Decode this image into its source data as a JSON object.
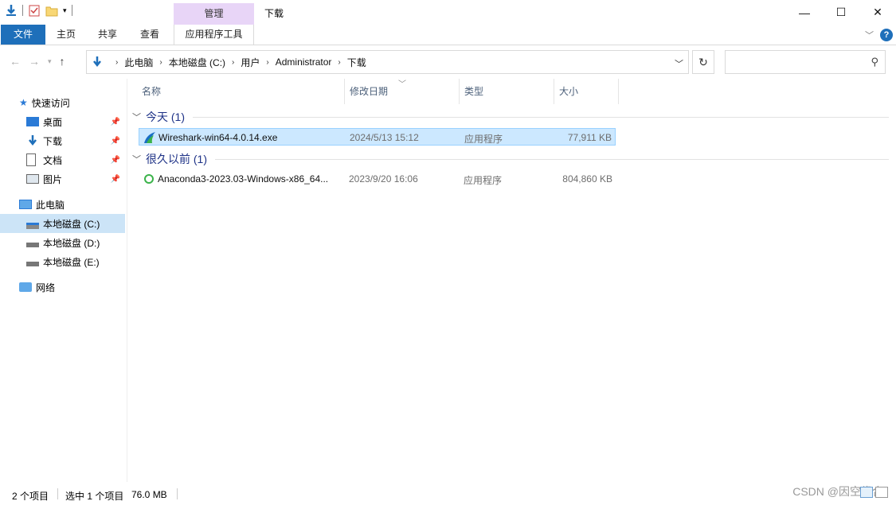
{
  "window": {
    "title": "下载",
    "context_tab_group": "管理",
    "controls": {
      "minimize": "—",
      "maximize": "☐",
      "close": "✕"
    }
  },
  "ribbon": {
    "tabs": [
      {
        "label": "文件"
      },
      {
        "label": "主页"
      },
      {
        "label": "共享"
      },
      {
        "label": "查看"
      },
      {
        "label": "应用程序工具"
      }
    ],
    "help": "?"
  },
  "address": {
    "breadcrumbs": [
      "此电脑",
      "本地磁盘 (C:)",
      "用户",
      "Administrator",
      "下载"
    ],
    "search_placeholder": ""
  },
  "navpane": {
    "quick_access": "快速访问",
    "quick_items": [
      {
        "label": "桌面",
        "icon": "desktop-icon"
      },
      {
        "label": "下载",
        "icon": "download-icon"
      },
      {
        "label": "文档",
        "icon": "document-icon"
      },
      {
        "label": "图片",
        "icon": "picture-icon"
      }
    ],
    "this_pc": "此电脑",
    "drives": [
      {
        "label": "本地磁盘 (C:)"
      },
      {
        "label": "本地磁盘 (D:)"
      },
      {
        "label": "本地磁盘 (E:)"
      }
    ],
    "network": "网络"
  },
  "columns": {
    "name": "名称",
    "date": "修改日期",
    "type": "类型",
    "size": "大小"
  },
  "groups": [
    {
      "label": "今天 (1)",
      "files": [
        {
          "name": "Wireshark-win64-4.0.14.exe",
          "date": "2024/5/13 15:12",
          "type": "应用程序",
          "size": "77,911 KB",
          "icon": "wireshark-icon"
        }
      ]
    },
    {
      "label": "很久以前 (1)",
      "files": [
        {
          "name": "Anaconda3-2023.03-Windows-x86_64...",
          "date": "2023/9/20 16:06",
          "type": "应用程序",
          "size": "804,860 KB",
          "icon": "anaconda-icon"
        }
      ]
    }
  ],
  "status": {
    "count": "2 个项目",
    "selection": "选中 1 个项目",
    "selection_size": "76.0 MB"
  },
  "watermark": "CSDN @因空缘合"
}
